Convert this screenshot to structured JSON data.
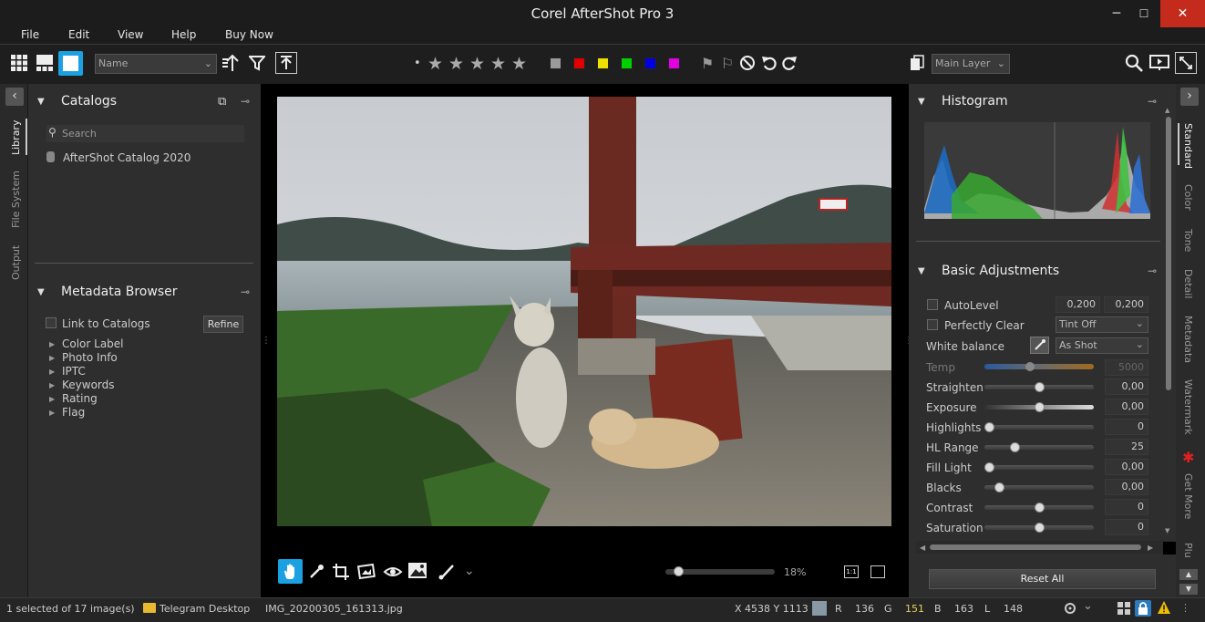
{
  "window": {
    "title": "Corel AfterShot Pro 3",
    "min": "─",
    "max": "☐",
    "close": "✕"
  },
  "menu": [
    "File",
    "Edit",
    "View",
    "Help",
    "Buy Now"
  ],
  "toolbar": {
    "sort_field": "Name",
    "layer": "Main Layer",
    "dot": "•",
    "stars": 5,
    "color_labels": [
      "#9a9a9a",
      "#e00000",
      "#f0e000",
      "#00d000",
      "#0000e0",
      "#e000e0"
    ]
  },
  "left_tabs": [
    "Library",
    "File System",
    "Output"
  ],
  "catalogs": {
    "title": "Catalogs",
    "search_placeholder": "Search",
    "items": [
      "AfterShot Catalog 2020"
    ]
  },
  "metadata": {
    "title": "Metadata Browser",
    "link_label": "Link to Catalogs",
    "refine": "Refine",
    "items": [
      "Color Label",
      "Photo Info",
      "IPTC",
      "Keywords",
      "Rating",
      "Flag"
    ]
  },
  "histogram": {
    "title": "Histogram"
  },
  "basic": {
    "title": "Basic Adjustments",
    "autolevel": {
      "label": "AutoLevel",
      "v1": "0,200",
      "v2": "0,200"
    },
    "perfectly_clear": {
      "label": "Perfectly Clear",
      "value": "Tint Off"
    },
    "white_balance": {
      "label": "White balance",
      "value": "As Shot"
    },
    "temp": {
      "label": "Temp",
      "value": "5000"
    },
    "sliders": [
      {
        "label": "Straighten",
        "value": "0,00",
        "pos": 0.5
      },
      {
        "label": "Exposure",
        "value": "0,00",
        "pos": 0.5
      },
      {
        "label": "Highlights",
        "value": "0",
        "pos": 0.0
      },
      {
        "label": "HL Range",
        "value": "25",
        "pos": 0.25
      },
      {
        "label": "Fill Light",
        "value": "0,00",
        "pos": 0.0
      },
      {
        "label": "Blacks",
        "value": "0,00",
        "pos": 0.1
      },
      {
        "label": "Contrast",
        "value": "0",
        "pos": 0.5
      },
      {
        "label": "Saturation",
        "value": "0",
        "pos": 0.5
      }
    ],
    "reset": "Reset All"
  },
  "right_tabs": [
    "Standard",
    "Color",
    "Tone",
    "Detail",
    "Metadata",
    "Watermark",
    "Get More",
    "Plugins"
  ],
  "zoom": "18%",
  "status": {
    "selected": "1 selected of 17 image(s)",
    "folder": "Telegram Desktop",
    "file": "IMG_20200305_161313.jpg",
    "coords": "X 4538  Y 1113",
    "r_label": "R",
    "r": "136",
    "g_label": "G",
    "g": "151",
    "b_label": "B",
    "b": "163",
    "l_label": "L",
    "l": "148"
  }
}
